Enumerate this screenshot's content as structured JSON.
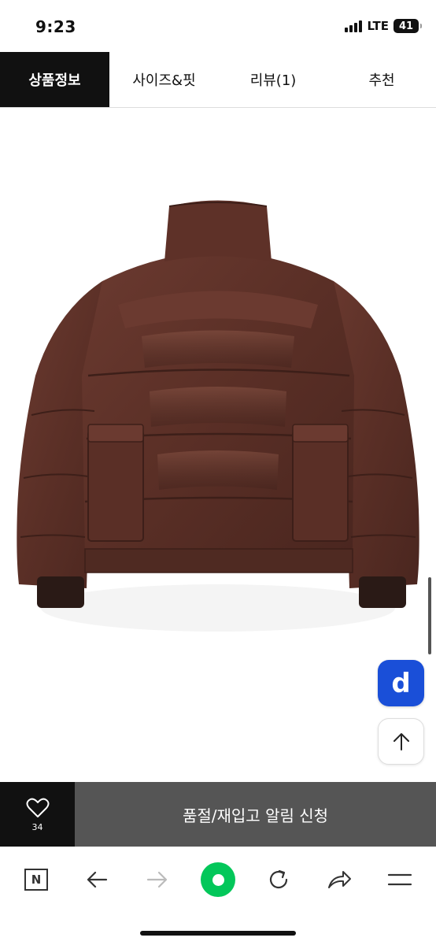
{
  "status_bar": {
    "time": "9:23",
    "network": "LTE",
    "battery": "41"
  },
  "tabs": [
    {
      "label": "상품정보",
      "active": true
    },
    {
      "label": "사이즈&핏",
      "active": false
    },
    {
      "label": "리뷰(1)",
      "active": false
    },
    {
      "label": "추천",
      "active": false
    }
  ],
  "product_image": {
    "icon": "brown-puffer-jacket-back-image",
    "jacket_color": "#5a2f26"
  },
  "floating": {
    "app_badge_label": "d",
    "app_badge_color": "#1a4fd8",
    "scroll_top_icon": "arrow-up-icon"
  },
  "purchase_bar": {
    "wish_icon": "heart-icon",
    "wish_count": "34",
    "notify_label": "품절/재입고 알림 신청"
  },
  "browser_toolbar": {
    "n_label": "N",
    "items": [
      "naver-home-icon",
      "back-arrow-icon",
      "forward-arrow-icon",
      "green-dot-icon",
      "refresh-icon",
      "share-icon",
      "menu-icon"
    ],
    "accent": "#03c75a"
  }
}
